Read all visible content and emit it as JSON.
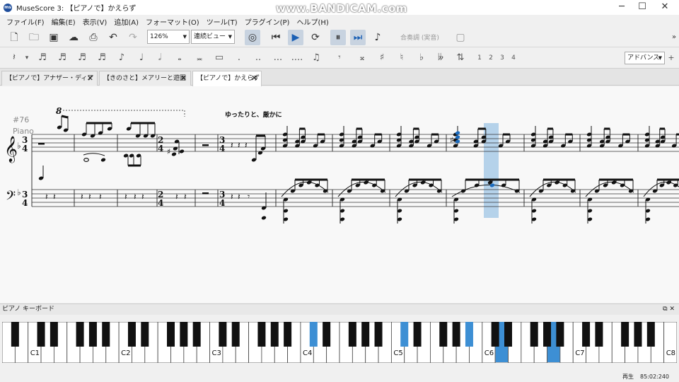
{
  "window": {
    "title": "MuseScore 3: 【ピアノで】かえらず",
    "app_icon": "musescore-icon",
    "watermark": "www.BANDICAM.com"
  },
  "menu": [
    "ファイル(F)",
    "編集(E)",
    "表示(V)",
    "追加(A)",
    "フォーマット(O)",
    "ツール(T)",
    "プラグイン(P)",
    "ヘルプ(H)"
  ],
  "toolbar": {
    "zoom": "126%",
    "view_mode": "連続ビュー",
    "concert_pitch": "合奏調 (実音)"
  },
  "note_input": {
    "voices": [
      "1",
      "2",
      "3",
      "4"
    ],
    "workspace": "アドバンス"
  },
  "tabs": [
    {
      "label": "【ピアノで】アナザー・ディアレスト",
      "active": false
    },
    {
      "label": "【きのさと】メアリーと遊園地",
      "active": false
    },
    {
      "label": "【ピアノで】かえらず",
      "active": true
    }
  ],
  "score": {
    "rehearsal_mark": "#76",
    "instrument": "Piano",
    "ottava": "8",
    "tempo_text": "ゆったりと、厳かに"
  },
  "keyboard_panel": {
    "title": "ピアノ キーボード",
    "octave_labels": [
      "C1",
      "C2",
      "C3",
      "C4",
      "C5",
      "C6",
      "C7",
      "C8"
    ]
  },
  "colors": {
    "selection": "#a9cbe8",
    "selected_note": "#1a6bbf",
    "pressed_key": "#3d8fd4"
  },
  "status": {
    "state": "再生",
    "time": "85:02:240"
  }
}
